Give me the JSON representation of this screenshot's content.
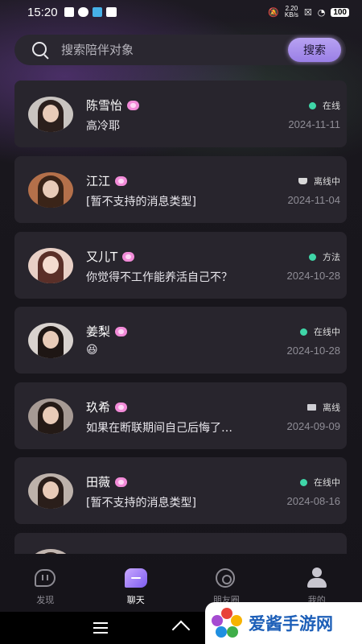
{
  "status_bar": {
    "time": "15:20",
    "net_speed_value": "2.20",
    "net_speed_unit": "KB/s",
    "battery": "100"
  },
  "search": {
    "placeholder": "搜索陪伴对象",
    "button_label": "搜索"
  },
  "chats": [
    {
      "name": "陈雪怡",
      "message": "高冷耶",
      "status": "在线",
      "status_type": "online",
      "date": "2024-11-11"
    },
    {
      "name": "江江",
      "message": "[暂不支持的消息类型]",
      "status": "离线中",
      "status_type": "away",
      "date": "2024-11-04"
    },
    {
      "name": "又儿T",
      "message": "你觉得不工作能养活自己不？",
      "status": "方法",
      "status_type": "online",
      "date": "2024-10-28"
    },
    {
      "name": "姜梨",
      "message": "😆",
      "status": "在线中",
      "status_type": "online",
      "date": "2024-10-28"
    },
    {
      "name": "玖希",
      "message": "如果在断联期间自己后悔了…",
      "status": "离线",
      "status_type": "offline",
      "date": "2024-09-09"
    },
    {
      "name": "田薇",
      "message": "[暂不支持的消息类型]",
      "status": "在线中",
      "status_type": "online",
      "date": "2024-08-16"
    }
  ],
  "nav": {
    "discover": "发现",
    "chat": "聊天",
    "moments": "朋友圈",
    "mine": "我的"
  },
  "watermark": {
    "text": "爱酱手游网"
  },
  "colors": {
    "online": "#3fd6a8",
    "card_bg": "#28252d",
    "accent": "#9a7fe6"
  }
}
